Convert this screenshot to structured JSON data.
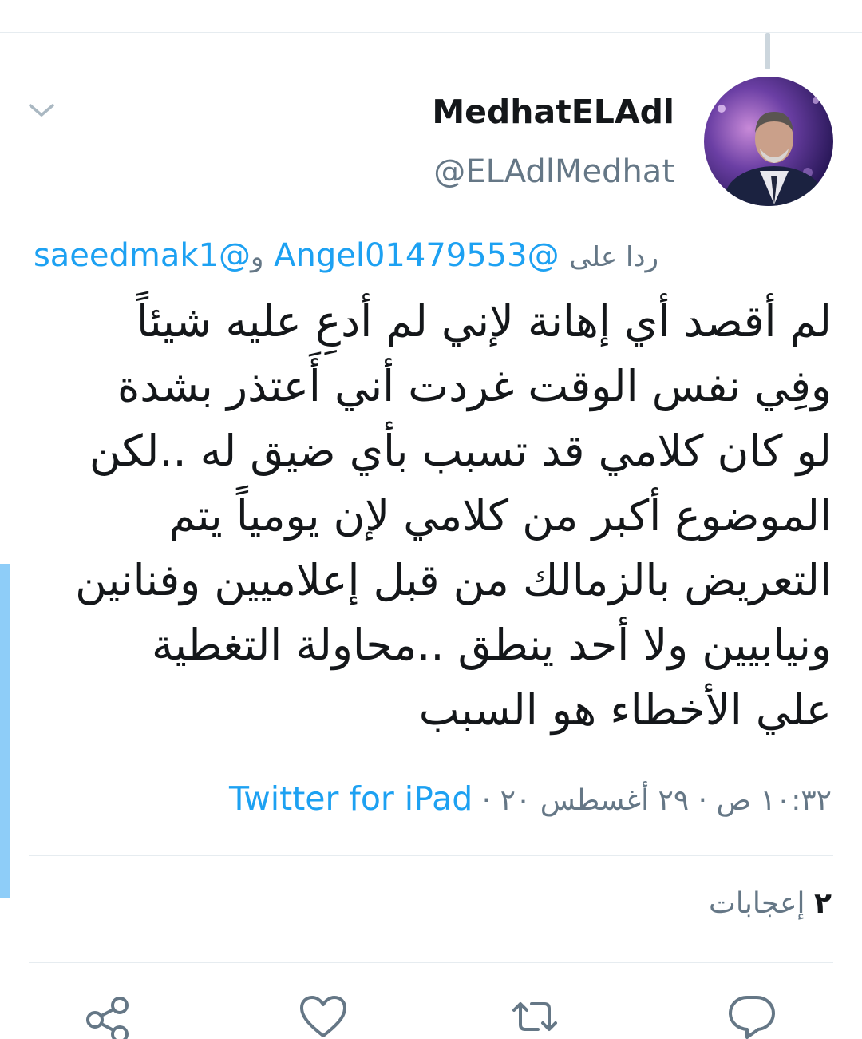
{
  "author": {
    "display_name": "MedhatELAdl",
    "handle": "@ELAdlMedhat"
  },
  "reply_context": {
    "prefix": "ردا على",
    "mentions": [
      "@Angel01479553",
      "@saeedmak1"
    ],
    "joiner": "و"
  },
  "tweet": {
    "lines": [
      "لم أقصد أي إهانة لإني لم أدعِ عليه شيئاً",
      "وفِي نفس الوقت غردت أني أَعتذر بشدة",
      "لو كان كلامي قد تسبب بأي ضيق له ..لكن",
      "الموضوع أكبر من كلامي لإن يومياً يتم",
      "التعريض بالزمالك من قبل إعلاميين وفنانين",
      "ونيابيين ولا أحد ينطق ..محاولة التغطية",
      "علي الأخطاء هو السبب"
    ]
  },
  "meta": {
    "time": "١٠:٣٢ ص",
    "date": "٢٩ أغسطس ٢٠",
    "separator": "·",
    "source": "Twitter for iPad"
  },
  "stats": {
    "likes_count": "٢",
    "likes_label": "إعجابات"
  },
  "icons": {
    "caret": "chevron-down-icon",
    "reply": "reply-icon",
    "retweet": "retweet-icon",
    "like": "heart-icon",
    "share": "share-icon"
  },
  "colors": {
    "link": "#1da1f2",
    "secondary_text": "#657786",
    "primary_text": "#14171a",
    "divider": "#e6ecf0",
    "thread_line": "#ccd6dd",
    "accent_bar": "#8ecdf8"
  }
}
